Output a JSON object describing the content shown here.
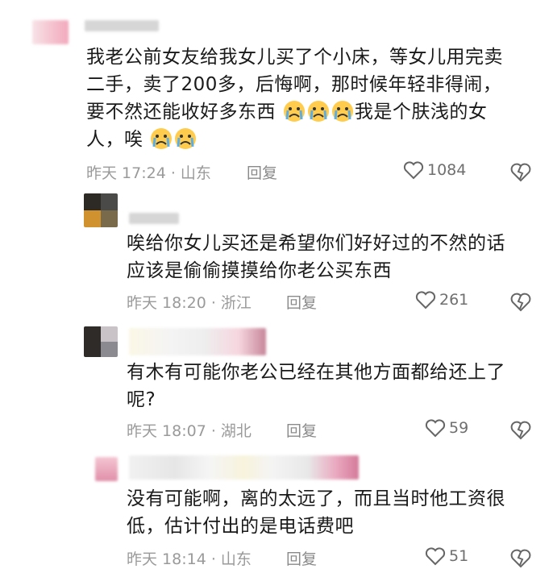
{
  "comments": [
    {
      "text": "我老公前女友给我女儿买了个小床，等女儿用完卖二手，卖了200多，后悔啊，那时候年轻非得闹，要不然还能收好多东西",
      "text_tail": "我是个肤浅的女人，唉",
      "time": "昨天 17:24",
      "location": "山东",
      "reply": "回复",
      "likes": "1084"
    },
    {
      "text": "唉给你女儿买还是希望你们好好过的不然的话应该是偷偷摸摸给你老公买东西",
      "time": "昨天 18:20",
      "location": "浙江",
      "reply": "回复",
      "likes": "261"
    },
    {
      "text": "有木有可能你老公已经在其他方面都给还上了呢?",
      "time": "昨天 18:07",
      "location": "湖北",
      "reply": "回复",
      "likes": "59"
    },
    {
      "text": "没有可能啊，离的太远了，而且当时他工资很低，估计付出的是电话费吧",
      "time": "昨天 18:14",
      "location": "山东",
      "reply": "回复",
      "likes": "51"
    }
  ],
  "icons": {
    "like": "heart-outline-icon",
    "dislike": "broken-heart-icon",
    "emoji": "crying-face-emoji"
  }
}
